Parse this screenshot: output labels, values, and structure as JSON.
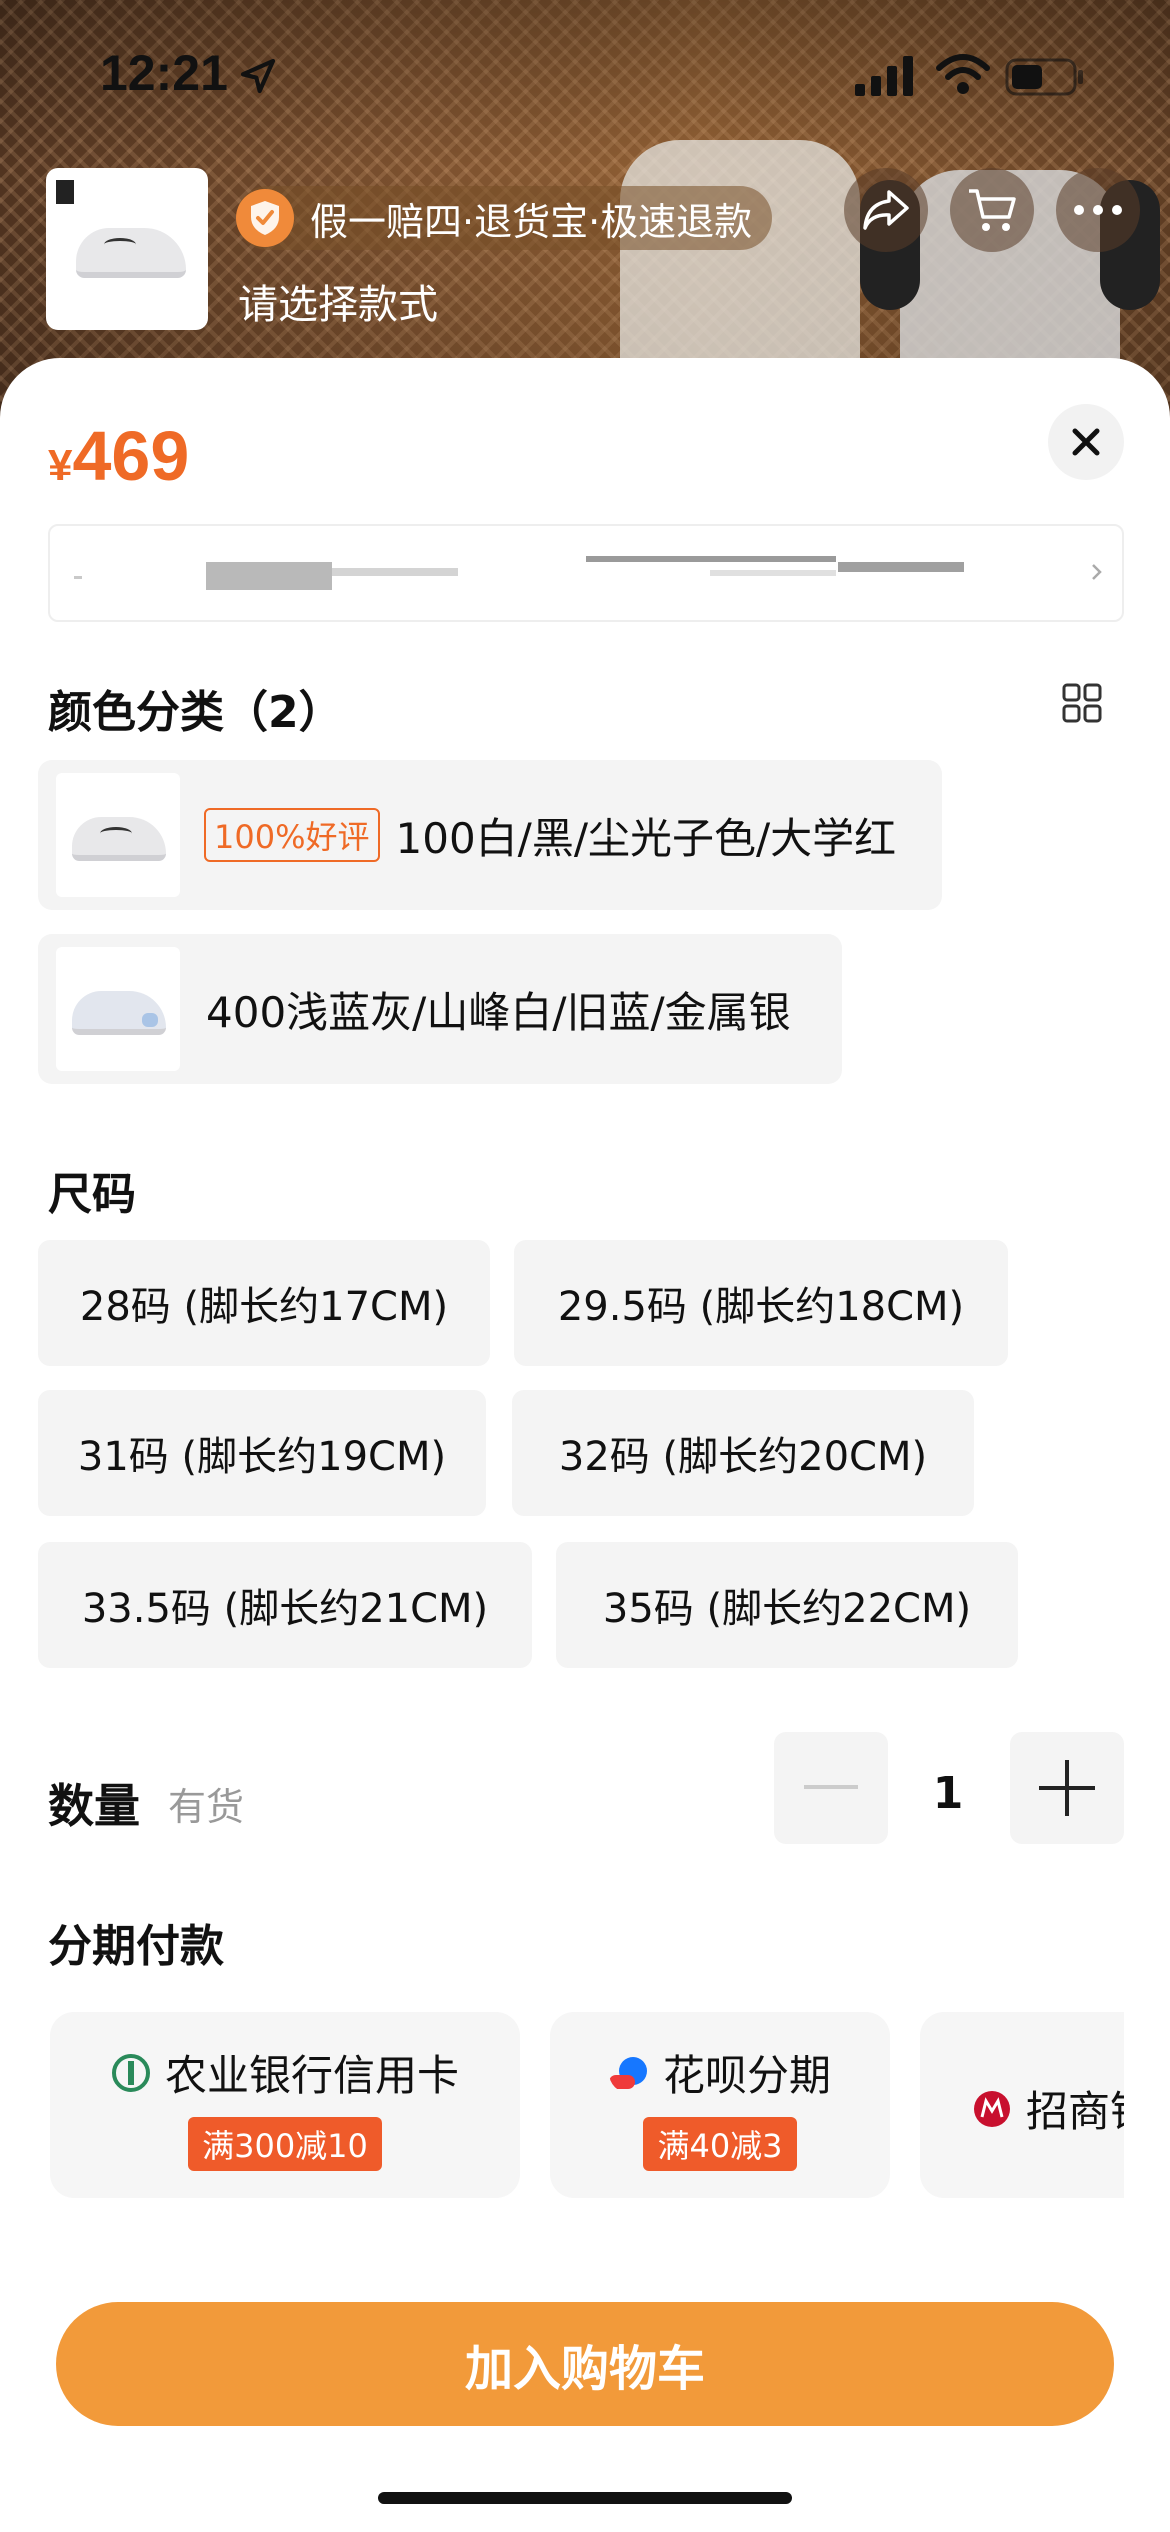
{
  "status_bar": {
    "time": "12:21"
  },
  "header": {
    "guarantee": "假一赔四·退货宝·极速退款",
    "select_hint": "请选择款式"
  },
  "price": {
    "currency": "¥",
    "amount": "469"
  },
  "color_section": {
    "title": "颜色分类（2）",
    "options": [
      {
        "badge": "100%好评",
        "label": "100白/黑/尘光子色/大学红"
      },
      {
        "badge": "",
        "label": "400浅蓝灰/山峰白/旧蓝/金属银"
      }
    ]
  },
  "size_section": {
    "title": "尺码",
    "options": [
      "28码 (脚长约17CM)",
      "29.5码 (脚长约18CM)",
      "31码 (脚长约19CM)",
      "32码 (脚长约20CM)",
      "33.5码 (脚长约21CM)",
      "35码 (脚长约22CM)"
    ]
  },
  "quantity": {
    "label": "数量",
    "stock": "有货",
    "value": "1"
  },
  "installment": {
    "title": "分期付款",
    "cards": [
      {
        "name": "农业银行信用卡",
        "promo": "满300减10",
        "icon": "abc-bank-icon"
      },
      {
        "name": "花呗分期",
        "promo": "满40减3",
        "icon": "huabei-icon"
      },
      {
        "name": "招商银行",
        "promo": "",
        "icon": "cmb-bank-icon"
      }
    ]
  },
  "cart_button": "加入购物车",
  "colors": {
    "accent": "#ef6a26",
    "cart": "#f29a3a",
    "promo_bg": "#ef5b2a"
  }
}
